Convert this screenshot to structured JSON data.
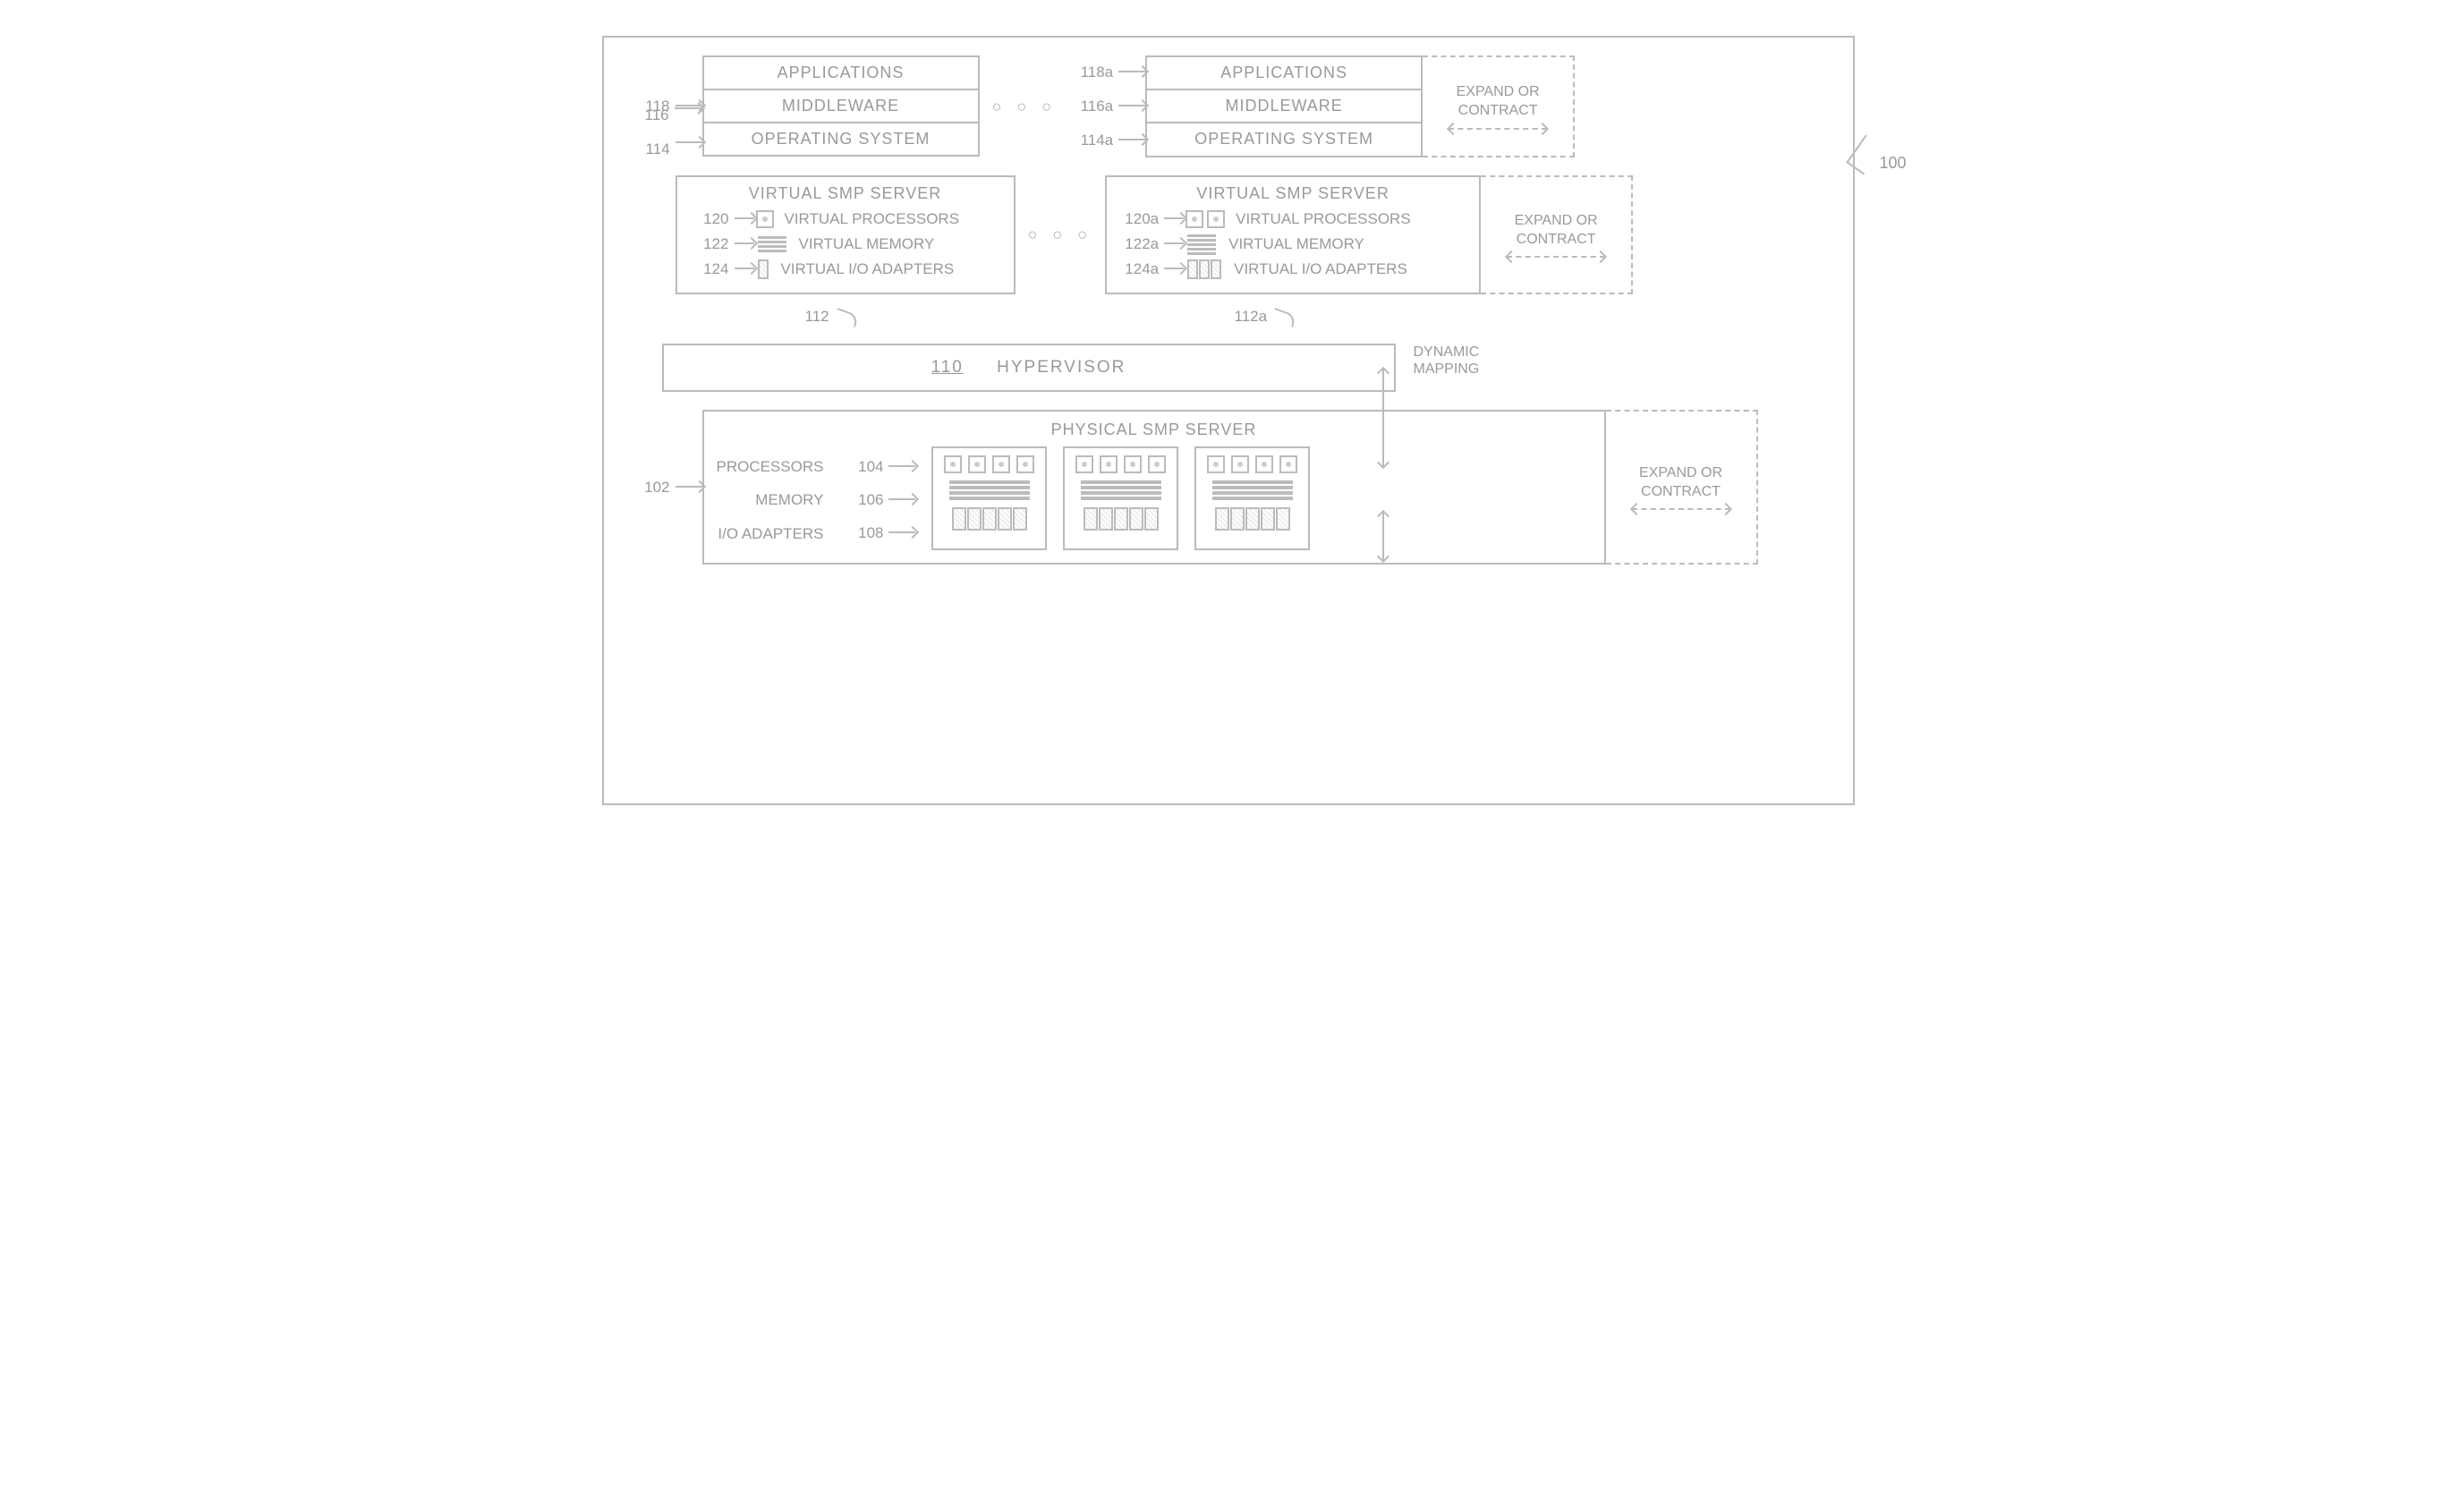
{
  "refs": {
    "outer": "100",
    "stack1": {
      "apps": "118",
      "mw": "116",
      "os": "114"
    },
    "stack2": {
      "apps": "118a",
      "mw": "116a",
      "os": "114a"
    },
    "vsmp1": {
      "box": "112",
      "vproc": "120",
      "vmem": "122",
      "vio": "124"
    },
    "vsmp2": {
      "box": "112a",
      "vproc": "120a",
      "vmem": "122a",
      "vio": "124a"
    },
    "hypervisor": "110",
    "physical": {
      "box": "102",
      "proc": "104",
      "mem": "106",
      "io": "108"
    }
  },
  "labels": {
    "apps": "APPLICATIONS",
    "mw": "MIDDLEWARE",
    "os": "OPERATING SYSTEM",
    "vsmp_title": "VIRTUAL SMP SERVER",
    "vproc": "VIRTUAL PROCESSORS",
    "vmem": "VIRTUAL MEMORY",
    "vio": "VIRTUAL I/O ADAPTERS",
    "hypervisor": "HYPERVISOR",
    "dynmap": "DYNAMIC\nMAPPING",
    "physical_title": "PHYSICAL SMP SERVER",
    "proc": "PROCESSORS",
    "mem": "MEMORY",
    "io": "I/O ADAPTERS",
    "expand": "EXPAND OR\nCONTRACT"
  }
}
